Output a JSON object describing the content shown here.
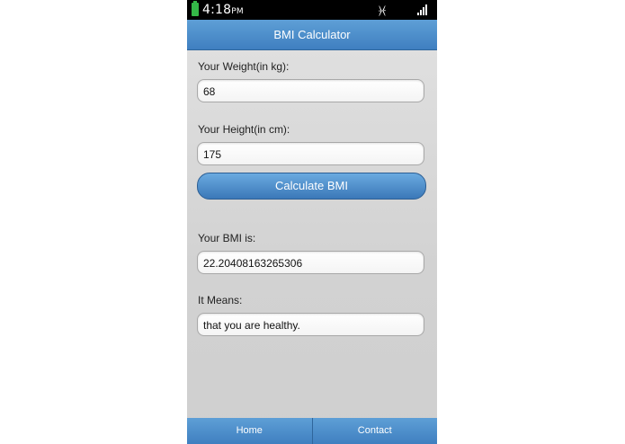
{
  "status_bar": {
    "time": "4:18",
    "ampm": "PM",
    "vibrate_icon": "vibrate-icon",
    "signal_icon": "signal-icon",
    "battery_icon": "battery-icon"
  },
  "header": {
    "title": "BMI Calculator"
  },
  "form": {
    "weight_label": "Your Weight(in kg):",
    "weight_value": "68",
    "height_label": "Your Height(in cm):",
    "height_value": "175",
    "calculate_label": "Calculate BMI"
  },
  "result": {
    "bmi_label": "Your BMI is:",
    "bmi_value": "22.20408163265306",
    "meaning_label": "It Means:",
    "meaning_value": "that you are healthy."
  },
  "nav": {
    "home_label": "Home",
    "contact_label": "Contact"
  },
  "colors": {
    "accent": "#4a8bcb",
    "battery": "#34b848"
  }
}
